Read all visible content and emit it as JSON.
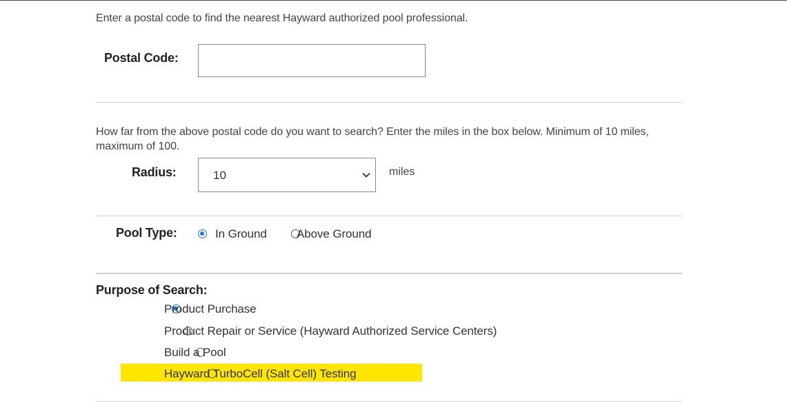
{
  "intro_text": "Enter a postal code to find the nearest Hayward authorized pool professional.",
  "postal": {
    "label": "Postal Code:",
    "value": ""
  },
  "radius": {
    "help_text": "How far from the above postal code do you want to search? Enter the miles in the box below. Minimum of 10 miles, maximum of 100.",
    "label": "Radius:",
    "selected_value": "10",
    "unit": "miles"
  },
  "pool_type": {
    "label": "Pool Type:",
    "options": [
      {
        "label": "In Ground",
        "checked": true
      },
      {
        "label": "Above Ground",
        "checked": false
      }
    ]
  },
  "purpose": {
    "label": "Purpose of Search:",
    "options": [
      {
        "label": "Product Purchase",
        "checked": true
      },
      {
        "label": "Product Repair or Service (Hayward Authorized Service Centers)",
        "checked": false
      },
      {
        "label": "Build a Pool",
        "checked": false
      },
      {
        "label": "Hayward TurboCell (Salt Cell) Testing",
        "checked": false,
        "highlighted": true
      }
    ]
  },
  "colors": {
    "accent": "#1a73e8",
    "highlight": "#ffe600",
    "divider": "#d6d6d6"
  }
}
